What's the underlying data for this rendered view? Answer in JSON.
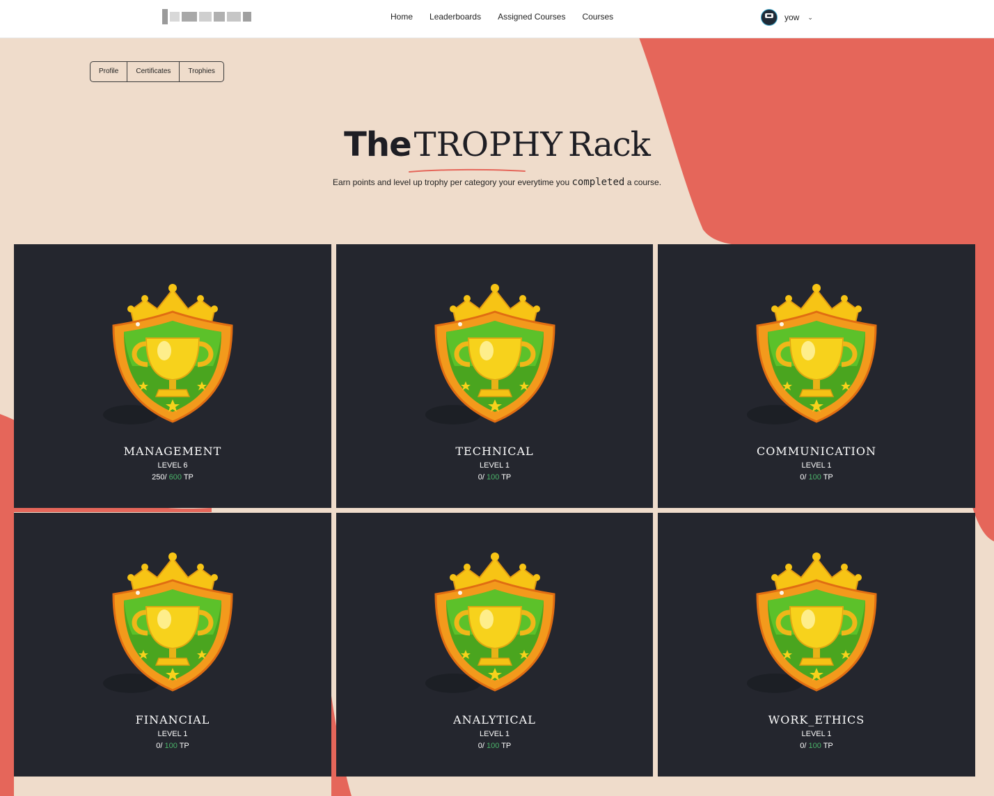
{
  "nav": {
    "links": [
      "Home",
      "Leaderboards",
      "Assigned Courses",
      "Courses"
    ],
    "user": "yow"
  },
  "tabs": [
    "Profile",
    "Certificates",
    "Trophies"
  ],
  "hero": {
    "title_part1": "The",
    "title_part2": "TROPHY",
    "title_part3": "Rack",
    "subtitle_before": "Earn points and level up trophy per category your everytime you",
    "subtitle_em": "completed",
    "subtitle_after": "a course."
  },
  "trophies": [
    {
      "name": "MANAGEMENT",
      "level": "LEVEL 6",
      "points": "250/",
      "max": "600",
      "unit": "TP"
    },
    {
      "name": "TECHNICAL",
      "level": "LEVEL 1",
      "points": "0/",
      "max": "100",
      "unit": "TP"
    },
    {
      "name": "COMMUNICATION",
      "level": "LEVEL 1",
      "points": "0/",
      "max": "100",
      "unit": "TP"
    },
    {
      "name": "FINANCIAL",
      "level": "LEVEL 1",
      "points": "0/",
      "max": "100",
      "unit": "TP"
    },
    {
      "name": "ANALYTICAL",
      "level": "LEVEL 1",
      "points": "0/",
      "max": "100",
      "unit": "TP"
    },
    {
      "name": "WORK_ETHICS",
      "level": "LEVEL 1",
      "points": "0/",
      "max": "100",
      "unit": "TP"
    }
  ],
  "colors": {
    "background": "#efdccb",
    "accent_blob": "#e5665a",
    "card": "#24262e",
    "points_max": "#4bb46a"
  }
}
